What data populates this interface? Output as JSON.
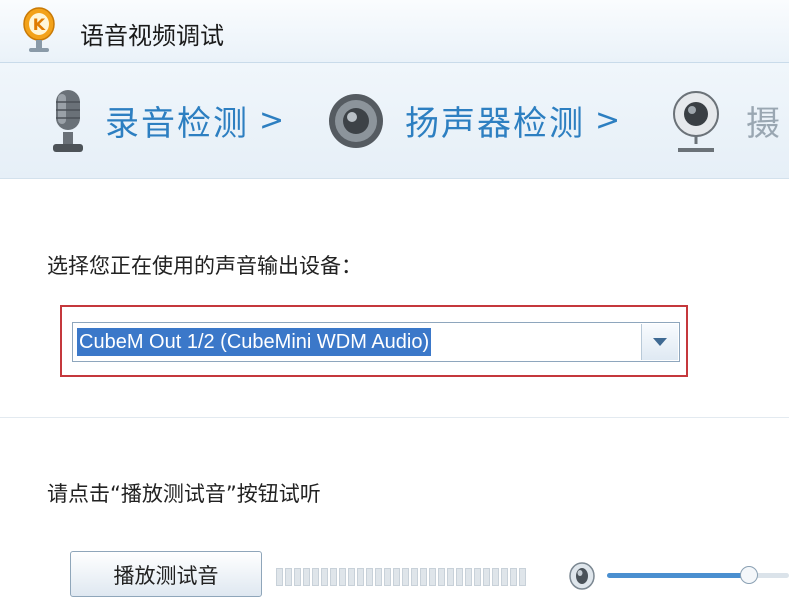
{
  "window": {
    "title": "语音视频调试",
    "app_icon": "kugou-k-icon"
  },
  "steps": [
    {
      "label": "录音检测",
      "icon": "microphone-icon",
      "arrow": ">"
    },
    {
      "label": "扬声器检测",
      "icon": "speaker-icon",
      "arrow": ">"
    },
    {
      "label": "摄",
      "icon": "webcam-icon"
    }
  ],
  "output_device": {
    "prompt": "选择您正在使用的声音输出设备：",
    "selected": "CubeM Out 1/2 (CubeMini WDM Audio)"
  },
  "test_sound": {
    "prompt": "请点击“播放测试音”按钮试听",
    "button_label": "播放测试音"
  },
  "volume": {
    "level": 0.78
  },
  "colors": {
    "accent": "#2d7fc1",
    "highlight_border": "#c5383c",
    "selection": "#3b78c9"
  }
}
